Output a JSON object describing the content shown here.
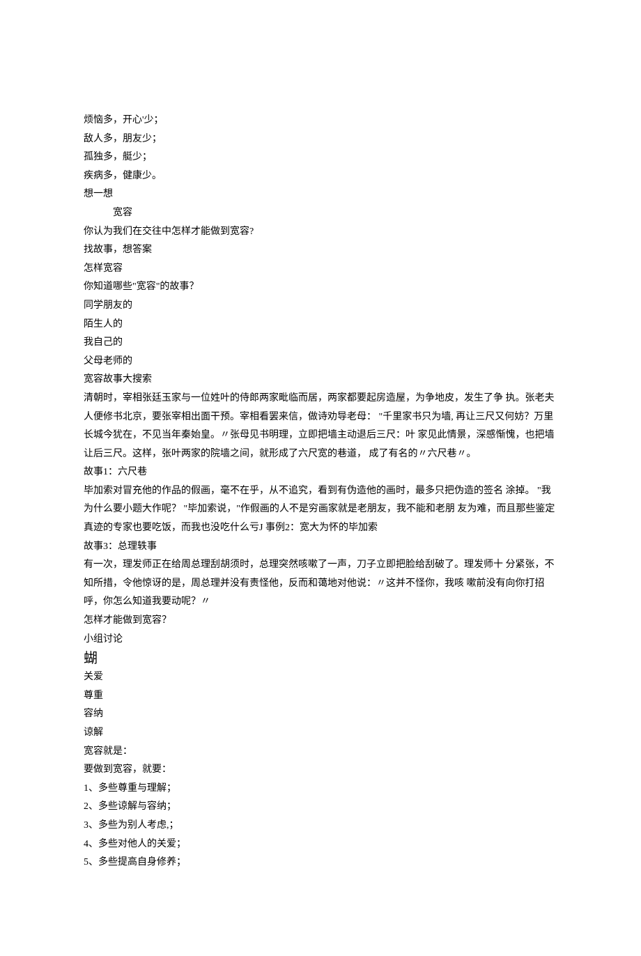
{
  "lines": [
    {
      "text": "烦恼多，开心'少；"
    },
    {
      "text": "敌人多，朋友少；"
    },
    {
      "text": "孤独多，艇少；"
    },
    {
      "text": "疾病多，健康少。"
    },
    {
      "text": "想一想"
    },
    {
      "text": "宽容",
      "indent": true
    },
    {
      "text": "你认为我们在交往中怎样才能做到宽容?"
    },
    {
      "text": "找故事，想答案"
    },
    {
      "text": "怎样宽容"
    },
    {
      "text": "你知道哪些\"宽容\"的故事？"
    },
    {
      "text": "同学朋友的"
    },
    {
      "text": "陌生人的"
    },
    {
      "text": "我自己的"
    },
    {
      "text": "父母老师的"
    },
    {
      "text": "宽容故事大搜索"
    },
    {
      "text": "清朝时，宰相张廷玉家与一位姓叶的侍郎两家毗临而居，两家都要起房造屋，为争地皮，发生了争 执。张老夫人便修书北京，要张宰相出面干预。宰相看罢来信，做诗劝导老母： \"千里家书只为墙,  再让三尺又何妨？万里长城今犹在，不见当年秦始皇。〃张母见书明理，立即把墙主动退后三尺：叶 家见此情景，深感惭愧，也把墙让后三尺。这样，张叶两家的院墙之间，就形成了六尺宽的巷道，   成了有名的〃六尺巷〃。"
    },
    {
      "text": "故事1：六尺巷"
    },
    {
      "text": "毕加索对冒充他的作品的假画，毫不在乎，从不追究，看到有伪造他的画时，最多只把伪造的签名 涂掉。 \"我为什么要小题大作呢？  \"毕加索说，\"作假画的人不是穷画家就是老朋友，我不能和老朋 友为难，而且那些鉴定真迹的专家也要吃饭，而我也没吃什么亏J  事例2：宽大为怀的毕加索"
    },
    {
      "text": "故事3：总理轶事"
    },
    {
      "text": "有一次，理发师正在给周总理刮胡须时，总理突然咳嗽了一声，刀子立即把脸给刮破了。理发师十 分紧张，不知所措，令他惊讶的是，周总理并没有责怪他，反而和蔼地对他说：〃这并不怪你，我咳 嗽前没有向你打招呼，你怎么知道我要动呢？〃"
    },
    {
      "text": "怎样才能做到宽容？"
    },
    {
      "text": "小组讨论"
    },
    {
      "text": "蝴",
      "large": true
    },
    {
      "text": "关爱"
    },
    {
      "text": "尊重"
    },
    {
      "text": "容纳"
    },
    {
      "text": "谅解"
    },
    {
      "text": "宽容就是："
    },
    {
      "text": "要做到宽容，就要："
    },
    {
      "text": "1、多些尊重与理解；"
    },
    {
      "text": "2、多些谅解与容纳；"
    },
    {
      "text": "3、多些为别人考虑,；"
    },
    {
      "text": "4、多些对他人的关爱；"
    },
    {
      "text": "5、多些提高自身修养；"
    }
  ]
}
